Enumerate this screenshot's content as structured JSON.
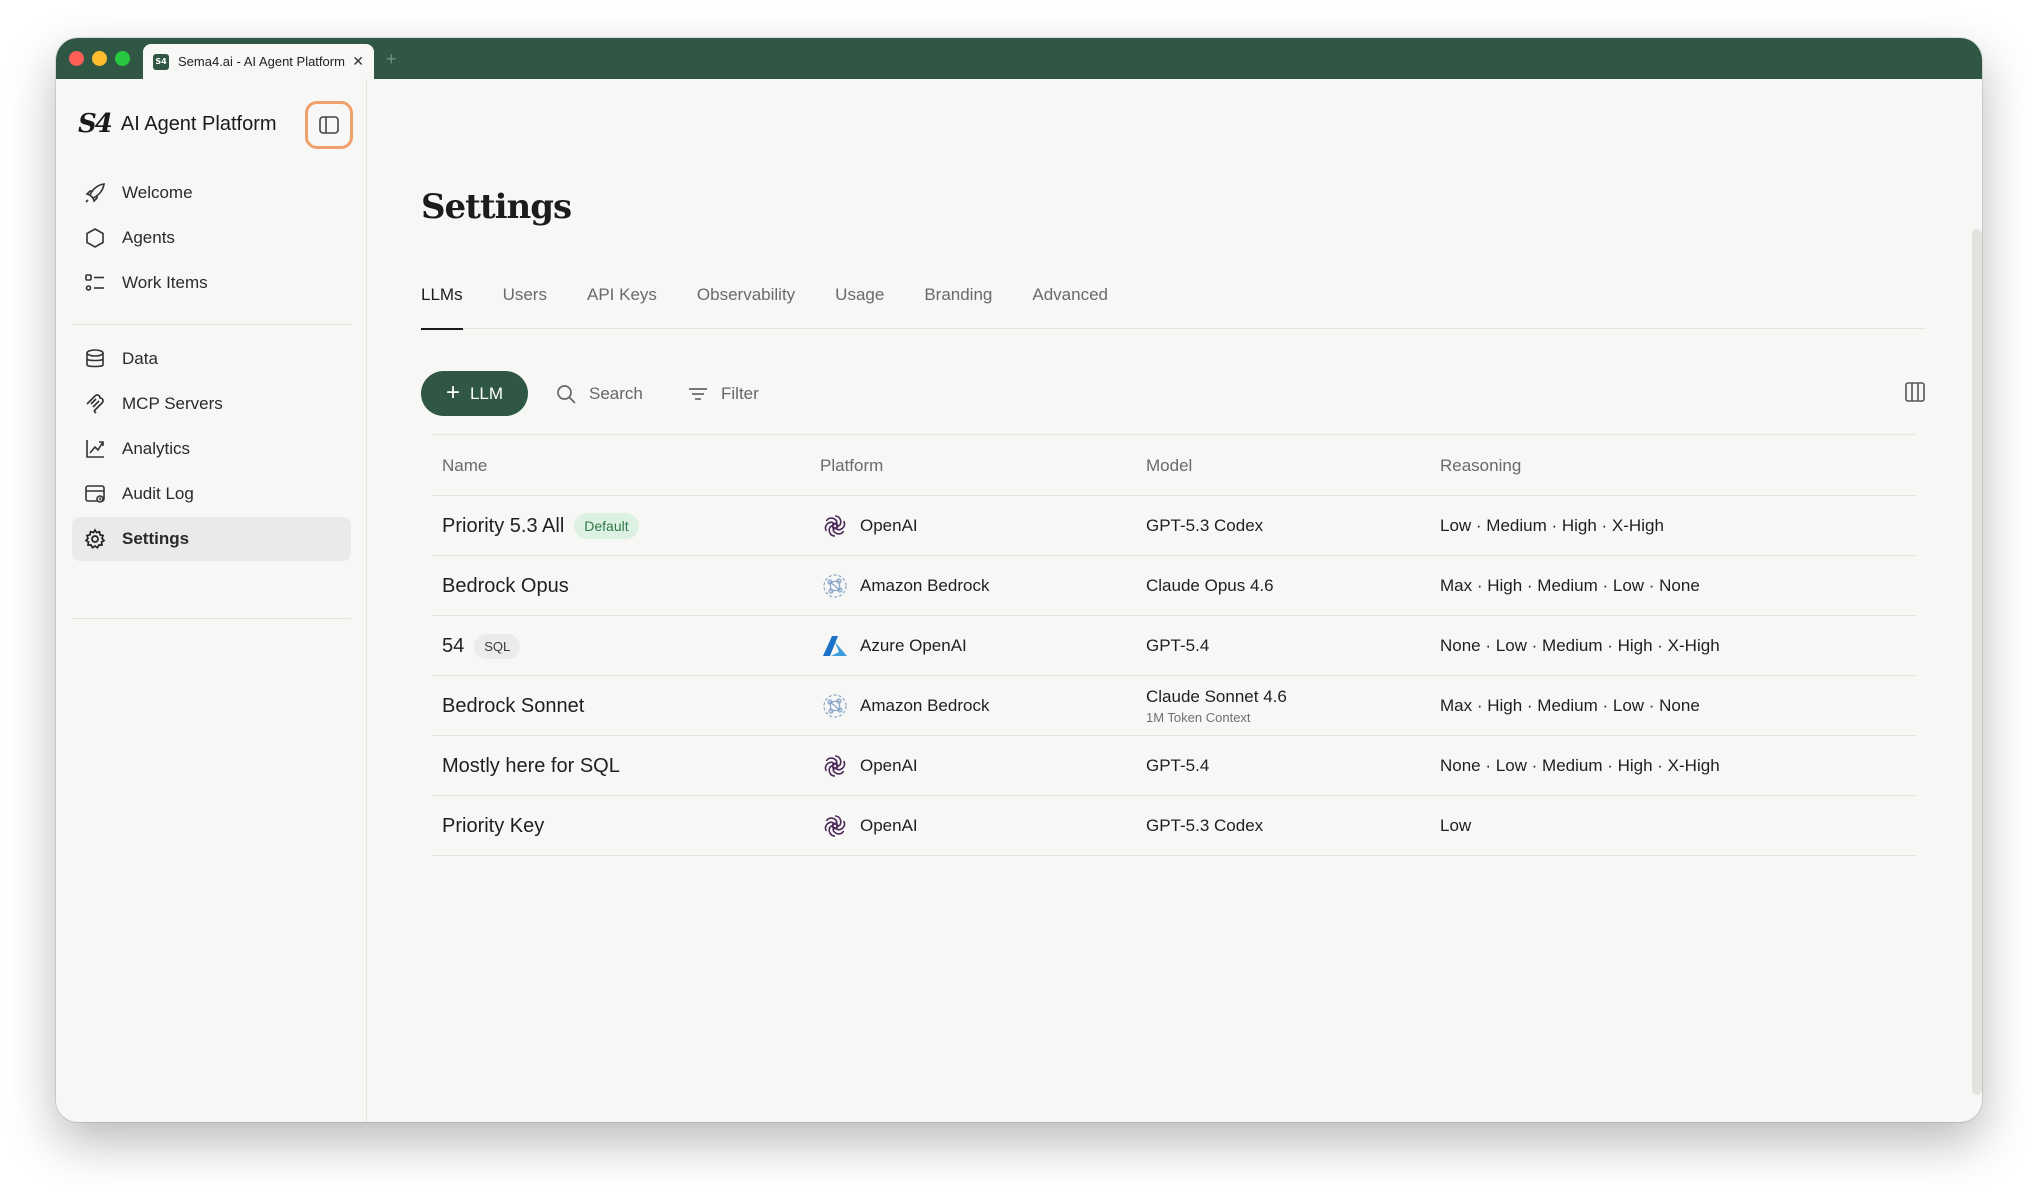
{
  "browser": {
    "tab_title": "Sema4.ai - AI Agent Platform",
    "favicon_text": "S4",
    "new_tab": "+"
  },
  "sidebar": {
    "logo": "S4",
    "brand": "AI Agent Platform",
    "group1": [
      {
        "label": "Welcome",
        "icon": "rocket-icon"
      },
      {
        "label": "Agents",
        "icon": "hexagon-icon"
      },
      {
        "label": "Work Items",
        "icon": "list-icon"
      }
    ],
    "group2": [
      {
        "label": "Data",
        "icon": "database-icon"
      },
      {
        "label": "MCP Servers",
        "icon": "mcp-icon"
      },
      {
        "label": "Analytics",
        "icon": "chart-icon"
      },
      {
        "label": "Audit Log",
        "icon": "audit-icon"
      },
      {
        "label": "Settings",
        "icon": "gear-icon",
        "active": true
      }
    ]
  },
  "main": {
    "title": "Settings",
    "tabs": [
      "LLMs",
      "Users",
      "API Keys",
      "Observability",
      "Usage",
      "Branding",
      "Advanced"
    ],
    "active_tab": "LLMs",
    "toolbar": {
      "add_plus": "+",
      "add_label": "LLM",
      "search_label": "Search",
      "filter_label": "Filter"
    },
    "table": {
      "headers": {
        "name": "Name",
        "platform": "Platform",
        "model": "Model",
        "reasoning": "Reasoning"
      },
      "rows": [
        {
          "name": "Priority 5.3 All",
          "badge": "Default",
          "platform": "OpenAI",
          "model": "GPT-5.3 Codex",
          "model_sub": "",
          "reasoning": "Low · Medium · High · X-High"
        },
        {
          "name": "Bedrock Opus",
          "badge": "",
          "platform": "Amazon Bedrock",
          "model": "Claude Opus 4.6",
          "model_sub": "",
          "reasoning": "Max · High · Medium · Low · None"
        },
        {
          "name": "54",
          "badge": "SQL",
          "platform": "Azure OpenAI",
          "model": "GPT-5.4",
          "model_sub": "",
          "reasoning": "None · Low · Medium · High · X-High"
        },
        {
          "name": "Bedrock Sonnet",
          "badge": "",
          "platform": "Amazon Bedrock",
          "model": "Claude Sonnet 4.6",
          "model_sub": "1M Token Context",
          "reasoning": "Max · High · Medium · Low · None"
        },
        {
          "name": "Mostly here for SQL",
          "badge": "",
          "platform": "OpenAI",
          "model": "GPT-5.4",
          "model_sub": "",
          "reasoning": "None · Low · Medium · High · X-High"
        },
        {
          "name": "Priority Key",
          "badge": "",
          "platform": "OpenAI",
          "model": "GPT-5.3 Codex",
          "model_sub": "",
          "reasoning": "Low"
        }
      ]
    }
  },
  "colors": {
    "brand_green": "#2f5744",
    "badge_green_bg": "#ddf1e3",
    "badge_green_text": "#2f7a4a",
    "highlight_orange": "#f0a06a",
    "azure_blue": "#0a6fc9"
  }
}
